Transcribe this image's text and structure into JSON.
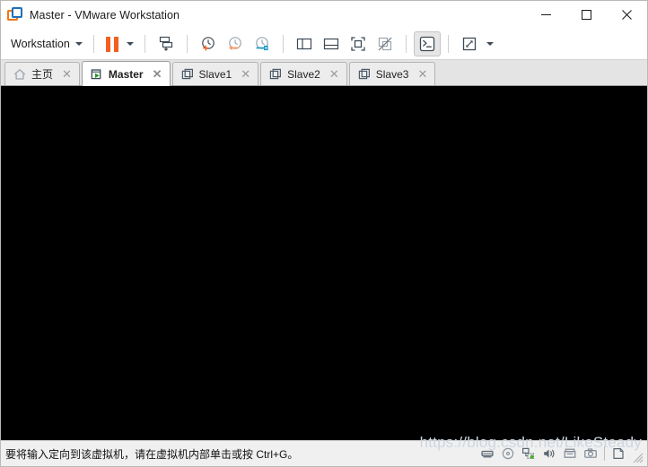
{
  "window": {
    "title": "Master - VMware Workstation",
    "logo_icon": "vmware-logo-icon",
    "minimize_label": "—",
    "maximize_label": "□",
    "close_label": "✕"
  },
  "toolbar": {
    "menu_label": "Workstation",
    "menu_caret_icon": "chevron-down-icon",
    "suspend_icon": "pause-icon",
    "suspend_caret_icon": "chevron-down-icon",
    "send_cad_icon": "send-ctrl-alt-del-icon",
    "take_snapshot_icon": "take-snapshot-clock-plus-icon",
    "revert_snapshot_icon": "revert-snapshot-clock-arrow-icon",
    "snapshot_manager_icon": "snapshot-manager-clock-wrench-icon",
    "show_library_icon": "show-library-panel-icon",
    "show_thumbnails_icon": "show-thumbnail-bar-icon",
    "full_screen_icon": "enter-full-screen-icon",
    "unity_mode_icon": "unity-mode-disabled-icon",
    "console_view_icon": "console-view-icon",
    "stretch_guest_icon": "stretch-guest-display-icon",
    "stretch_caret_icon": "chevron-down-icon"
  },
  "tabs": [
    {
      "label": "主页",
      "icon": "home-icon",
      "active": false,
      "close_label": "✕"
    },
    {
      "label": "Master",
      "icon": "vm-running-icon",
      "active": true,
      "close_label": "✕"
    },
    {
      "label": "Slave1",
      "icon": "vm-icon",
      "active": false,
      "close_label": "✕"
    },
    {
      "label": "Slave2",
      "icon": "vm-icon",
      "active": false,
      "close_label": "✕"
    },
    {
      "label": "Slave3",
      "icon": "vm-icon",
      "active": false,
      "close_label": "✕"
    }
  ],
  "vm_display": {
    "background_color": "#000000",
    "content": ""
  },
  "statusbar": {
    "message": "要将输入定向到该虚拟机，请在虚拟机内部单击或按 Ctrl+G。",
    "devices": [
      {
        "name": "hard-disk-icon"
      },
      {
        "name": "cd-dvd-icon"
      },
      {
        "name": "network-adapter-icon",
        "status_color": "#4caf28"
      },
      {
        "name": "sound-card-icon"
      },
      {
        "name": "printer-icon"
      },
      {
        "name": "camera-icon"
      }
    ],
    "extra_icon": "notes-page-icon",
    "resize_grip_icon": "resize-grip-icon",
    "watermark": "https://blog.csdn.net/LikeSteady"
  },
  "colors": {
    "accent_orange": "#f4601e",
    "logo_blue": "#1f6fb4",
    "icon_dark": "#3d4a55",
    "icon_teal": "#1f9ec4",
    "network_green": "#4caf28",
    "titlebar_bg": "#ffffff",
    "tabbar_bg": "#e4e4e4",
    "statusbar_bg": "#f0f0f0",
    "screen_black": "#000000"
  }
}
